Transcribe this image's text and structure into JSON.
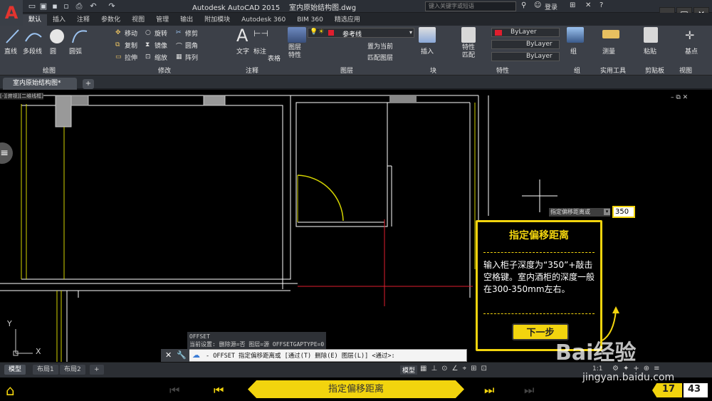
{
  "titlebar": {
    "app_name": "Autodesk AutoCAD 2015",
    "file_name": "室内原始结构图.dwg",
    "search_placeholder": "键入关键字或短语",
    "login": "登录"
  },
  "ribbon_tabs": [
    "默认",
    "插入",
    "注释",
    "参数化",
    "视图",
    "管理",
    "输出",
    "附加模块",
    "Autodesk 360",
    "BIM 360",
    "精选应用"
  ],
  "ribbon": {
    "draw": {
      "line": "直线",
      "polyline": "多段线",
      "circle": "圆",
      "arc": "圆弧",
      "panel": "绘图"
    },
    "modify": {
      "move": "移动",
      "rotate": "旋转",
      "trim": "修剪",
      "copy": "复制",
      "mirror": "镜像",
      "fillet": "圆角",
      "stretch": "拉伸",
      "scale": "缩放",
      "array": "阵列",
      "panel": "修改"
    },
    "annotation": {
      "text": "文字",
      "dim": "标注",
      "table": "表格",
      "panel": "注释"
    },
    "layers": {
      "props": "图层\n特性",
      "current_layer": "参考线",
      "set_current": "置为当前",
      "match": "匹配图层",
      "panel": "图层"
    },
    "block": {
      "insert": "插入",
      "panel": "块"
    },
    "properties": {
      "match": "特性\n匹配",
      "bylayer1": "ByLayer",
      "bylayer2": "ByLayer",
      "bylayer3": "ByLayer",
      "panel": "特性"
    },
    "groups": {
      "group": "组",
      "panel": "组"
    },
    "utilities": {
      "measure": "测量",
      "panel": "实用工具"
    },
    "clipboard": {
      "paste": "粘贴",
      "panel": "剪贴板"
    },
    "view": {
      "panel": "视图"
    },
    "base": {
      "label": "基点"
    }
  },
  "doc_tab": "室内原始结构图*",
  "viewport_label": "[-][俯视][二维线框]",
  "command": {
    "history_1": "OFFSET",
    "history_2": "当前设置: 删除源=否  图层=源  OFFSETGAPTYPE=0",
    "prompt": "- OFFSET 指定偏移距离或 [通过(T) 删除(E) 图层(L)] <通过>:"
  },
  "layout_tabs": [
    "模型",
    "布局1",
    "布局2"
  ],
  "status": {
    "model": "模型",
    "scale": "1:1"
  },
  "dyn_prompt": {
    "label": "指定偏移距离或",
    "value": "350"
  },
  "callout": {
    "title": "指定偏移距离",
    "body": "输入柜子深度为“350”+敲击空格键。室内酒柜的深度一般在300-350mm左右。",
    "next": "下一步"
  },
  "nav": {
    "title": "指定偏移距离",
    "current": "17",
    "total": "43"
  },
  "watermark": {
    "brand": "Bai经验",
    "url": "jingyan.baidu.com"
  },
  "colors": {
    "accent": "#f2d40e",
    "wall": "#ffffff",
    "layer_line": "#d4d400",
    "guide": "#e01e2e"
  }
}
